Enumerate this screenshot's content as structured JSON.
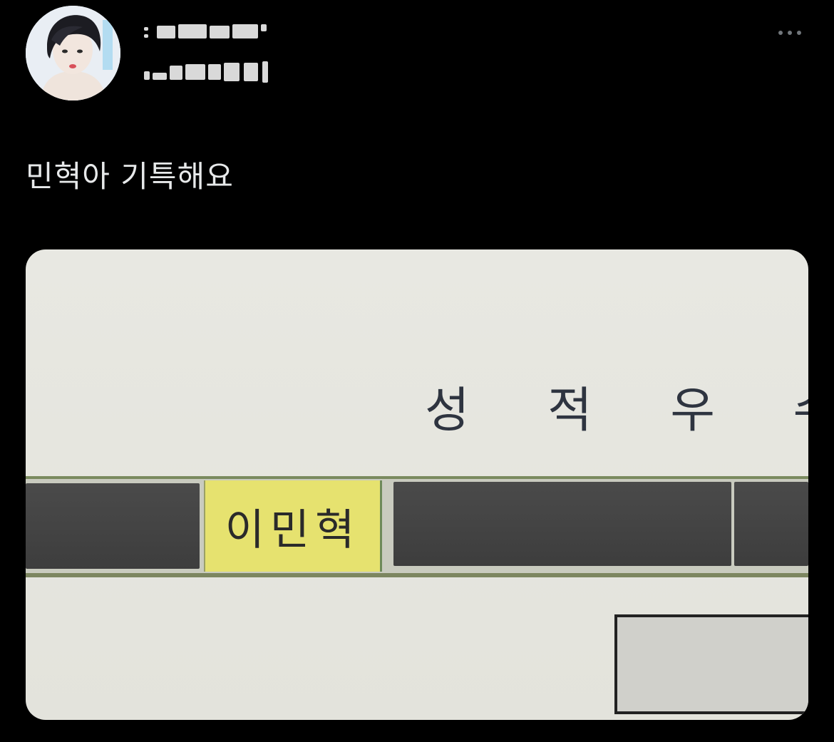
{
  "post": {
    "text": "민혁아 기특해요",
    "more_icon": "more-horizontal-icon"
  },
  "author": {
    "avatar_icon": "profile-avatar",
    "name_redacted": true,
    "handle_redacted": true
  },
  "media": {
    "title": "성 적 우 수 자",
    "highlighted_name": "이민혁",
    "highlight_color": "#e6e26f"
  },
  "colors": {
    "background": "#000000",
    "text": "#e7e9ea",
    "muted": "#71767b"
  }
}
